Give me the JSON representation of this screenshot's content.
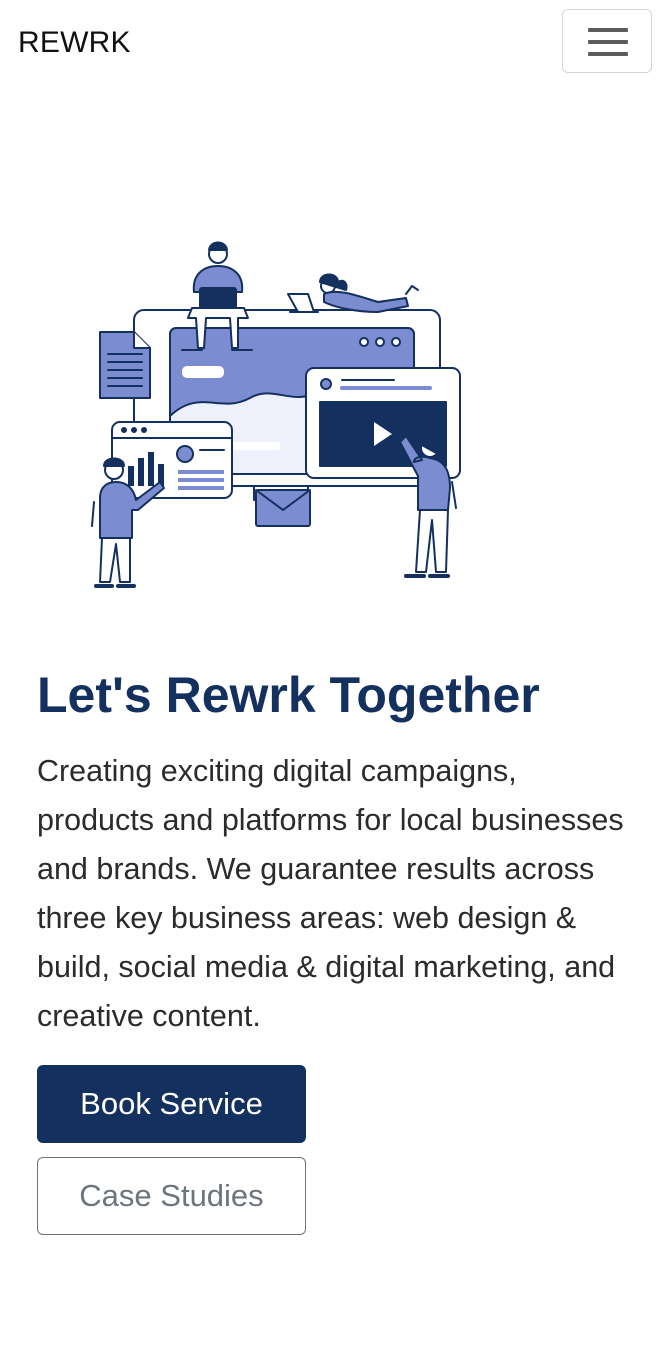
{
  "navbar": {
    "brand": "REWRK",
    "toggle_icon": "hamburger-menu-icon"
  },
  "hero": {
    "illustration_icon": "team-digital-marketing-illustration",
    "title": "Let's Rewrk Together",
    "description": "Creating exciting digital campaigns, products and platforms for local businesses and brands. We guarantee results across three key business areas: web design & build, social media & digital marketing, and creative content.",
    "primary_button": "Book Service",
    "secondary_button": "Case Studies"
  },
  "colors": {
    "brand_navy": "#14305e",
    "illustration_periwinkle": "#7b8cd0",
    "outline_gray": "#6c757d"
  }
}
